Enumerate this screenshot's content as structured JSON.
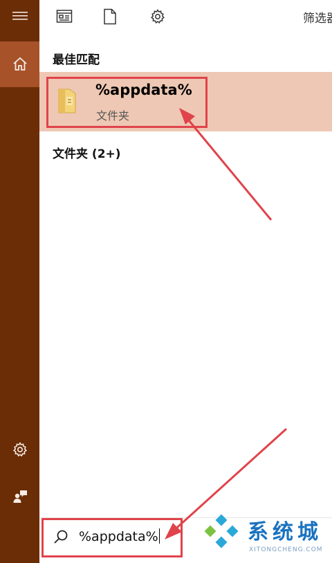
{
  "toolbar": {
    "filter_label": "筛选器"
  },
  "results": {
    "best_match_heading": "最佳匹配",
    "best_match": {
      "name": "%appdata%",
      "type": "文件夹"
    },
    "folders_heading": "文件夹 (2+)"
  },
  "search": {
    "query": "%appdata%"
  },
  "watermark": {
    "text": "系统城",
    "sub": "XITONGCHENG.COM"
  },
  "colors": {
    "rail": "#6b2d06",
    "rail_active": "#a8522a",
    "highlight": "#eec8b4",
    "annotation": "#e0434a"
  },
  "icons": {
    "menu": "hamburger-icon",
    "home": "home-icon",
    "settings": "gear-icon",
    "feedback": "feedback-icon",
    "apps": "apps-icon",
    "documents": "document-icon",
    "web": "gear-icon",
    "folder": "folder-icon",
    "search": "search-icon"
  }
}
